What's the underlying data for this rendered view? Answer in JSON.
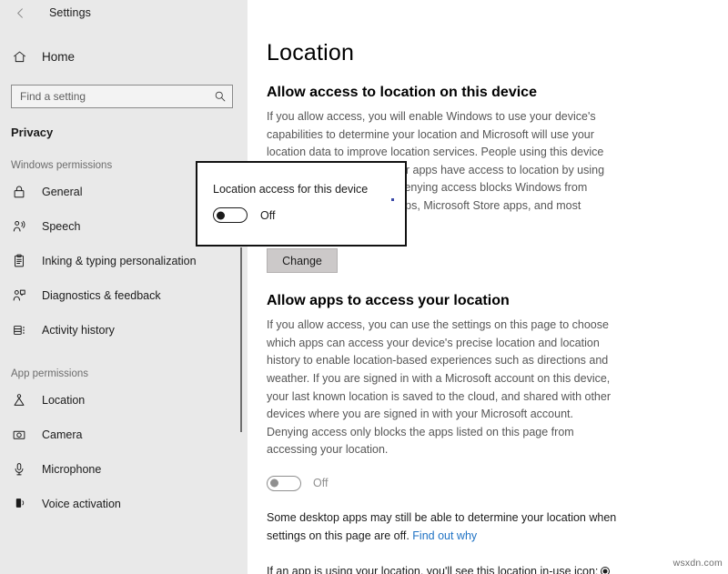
{
  "window": {
    "title": "Settings",
    "back_icon": "back-arrow-icon"
  },
  "sidebar": {
    "home": {
      "label": "Home",
      "icon": "home-icon"
    },
    "search": {
      "placeholder": "Find a setting",
      "value": "",
      "icon": "search-icon"
    },
    "category": "Privacy",
    "groups": [
      {
        "header": "Windows permissions",
        "items": [
          {
            "label": "General",
            "icon": "lock-icon"
          },
          {
            "label": "Speech",
            "icon": "speech-person-icon"
          },
          {
            "label": "Inking & typing personalization",
            "icon": "clipboard-pen-icon"
          },
          {
            "label": "Diagnostics & feedback",
            "icon": "person-feedback-icon"
          },
          {
            "label": "Activity history",
            "icon": "activity-history-icon"
          }
        ]
      },
      {
        "header": "App permissions",
        "items": [
          {
            "label": "Location",
            "icon": "location-pin-icon"
          },
          {
            "label": "Camera",
            "icon": "camera-icon"
          },
          {
            "label": "Microphone",
            "icon": "microphone-icon"
          },
          {
            "label": "Voice activation",
            "icon": "voice-activation-icon"
          }
        ]
      }
    ]
  },
  "main": {
    "page_title": "Location",
    "device_section": {
      "heading": "Allow access to location on this device",
      "description": "If you allow access, you will enable Windows to use your device's capabilities to determine your location and Microsoft will use your location data to improve location services. People using this device will be able to choose if their apps have access to location by using the settings on this page. Denying access blocks Windows from providing location to any apps, Microsoft Store apps, and most desktop apps.",
      "change_button": "Change"
    },
    "apps_section": {
      "heading": "Allow apps to access your location",
      "description": "If you allow access, you can use the settings on this page to choose which apps can access your device's precise location and location history to enable location-based experiences such as directions and weather. If you are signed in with a Microsoft account on this device, your last known location is saved to the cloud, and shared with other devices where you are signed in with your Microsoft account. Denying access only blocks the apps listed on this page from accessing your location.",
      "toggle_state": "Off",
      "note_before_link": "Some desktop apps may still be able to determine your location when settings on this page are off. ",
      "note_link": "Find out why",
      "inuse_note": "If an app is using your location, you'll see this location in-use icon:",
      "inuse_icon": "location-in-use-icon"
    }
  },
  "popup": {
    "title": "Location access for this device",
    "toggle_state": "Off",
    "toggle_icon": "toggle-switch-off"
  },
  "watermark": "wsxdn.com",
  "colors": {
    "sidebar_bg": "#e9e9e9",
    "main_bg": "#ffffff",
    "link": "#1f72c4",
    "button_bg": "#ccc9c9",
    "muted_text": "#565656"
  }
}
